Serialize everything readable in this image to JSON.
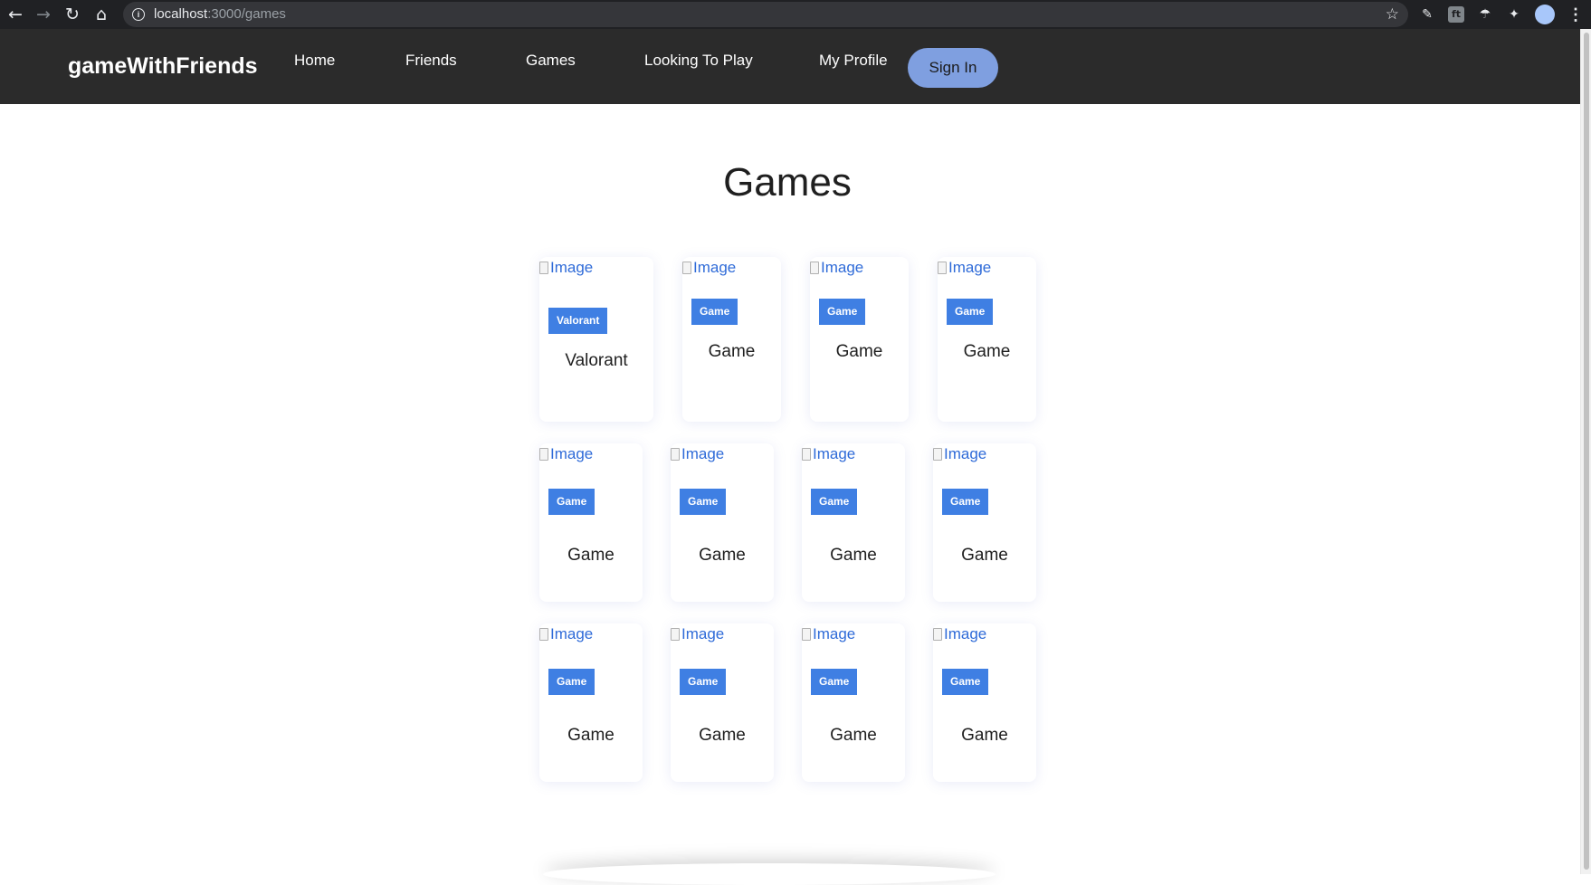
{
  "browser": {
    "url_host": "localhost",
    "url_path": ":3000/games",
    "icons": [
      "back-arrow-icon",
      "forward-arrow-icon",
      "reload-icon",
      "home-icon",
      "site-info-icon",
      "bookmark-star-icon",
      "extension-icon",
      "profile-avatar",
      "menu-kebab-icon"
    ]
  },
  "navbar": {
    "brand": "gameWithFriends",
    "links": [
      "Home",
      "Friends",
      "Games",
      "Looking To Play",
      "My Profile"
    ],
    "sign_in": "Sign In"
  },
  "page": {
    "title": "Games",
    "image_alt": "Image",
    "cards": [
      {
        "tag": "Valorant",
        "title": "Valorant"
      },
      {
        "tag": "Game",
        "title": "Game"
      },
      {
        "tag": "Game",
        "title": "Game"
      },
      {
        "tag": "Game",
        "title": "Game"
      },
      {
        "tag": "Game",
        "title": "Game"
      },
      {
        "tag": "Game",
        "title": "Game"
      },
      {
        "tag": "Game",
        "title": "Game"
      },
      {
        "tag": "Game",
        "title": "Game"
      },
      {
        "tag": "Game",
        "title": "Game"
      },
      {
        "tag": "Game",
        "title": "Game"
      },
      {
        "tag": "Game",
        "title": "Game"
      },
      {
        "tag": "Game",
        "title": "Game"
      }
    ]
  },
  "colors": {
    "navbar_bg": "#2b2b2b",
    "sign_in_bg": "#7f9fe0",
    "tag_bg": "#3f7fe3",
    "link_blue": "#2f6bd8"
  }
}
